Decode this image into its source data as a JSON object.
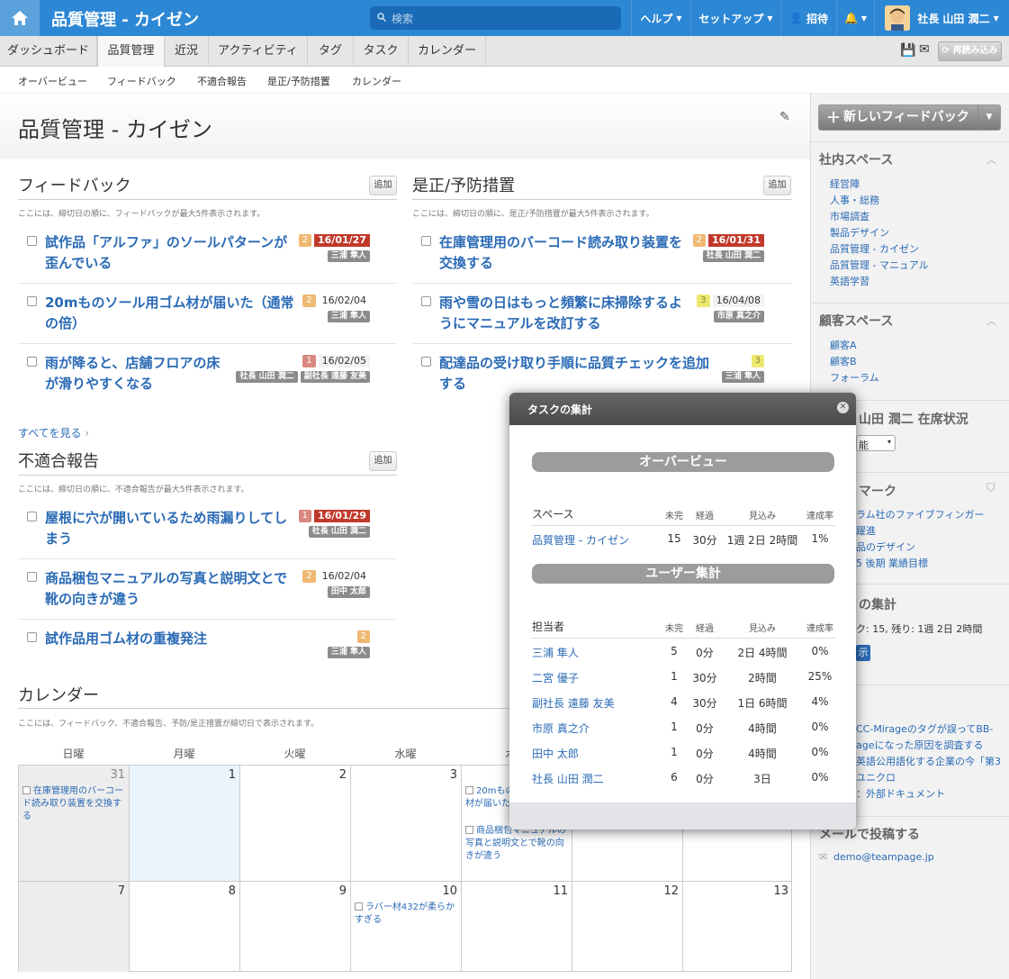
{
  "topbar": {
    "title": "品質管理 - カイゼン",
    "search_placeholder": "検索",
    "help": "ヘルプ",
    "setup": "セットアップ",
    "invite": "招待",
    "user": "社長 山田 潤二"
  },
  "tabs": [
    "ダッシュボード",
    "品質管理",
    "近況",
    "アクティビティ",
    "タグ",
    "タスク",
    "カレンダー"
  ],
  "reload": "再読み込み",
  "subnav": [
    "オーバービュー",
    "フィードバック",
    "不適合報告",
    "是正/予防措置",
    "カレンダー"
  ],
  "page_title": "品質管理 - カイゼン",
  "add_label": "追加",
  "feedback": {
    "title": "フィードバック",
    "desc": "ここには、締切日の順に、フィードバックが最大5件表示されます。",
    "items": [
      {
        "l1": "試作品「アルファ」のソールパターンが",
        "l2": "歪んでいる",
        "prio": "2",
        "date": "16/01/27",
        "who": [
          "三浦 隼人"
        ]
      },
      {
        "l1": "20mものソール用ゴム材が届いた（通常",
        "l2": "の倍）",
        "prio": "2",
        "date": "16/02/04",
        "who": [
          "三浦 隼人"
        ]
      },
      {
        "l1": "雨が降ると、店舗フロアの床",
        "l2": "が滑りやすくなる",
        "prio": "1",
        "date": "16/02/05",
        "who": [
          "社長 山田 潤二",
          "副社長 遠藤 友美"
        ]
      }
    ],
    "see_all": "すべてを見る"
  },
  "capa": {
    "title": "是正/予防措置",
    "desc": "ここには、締切日の順に、是正/予防措置が最大5件表示されます。",
    "items": [
      {
        "l1": "在庫管理用のバーコード読み取り装置を",
        "l2": "交換する",
        "prio": "2",
        "date": "16/01/31",
        "who": [
          "社長 山田 潤二"
        ]
      },
      {
        "l1": "雨や雪の日はもっと頻繁に床掃除するよ",
        "l2": "うにマニュアルを改訂する",
        "prio": "3",
        "date": "16/04/08",
        "who": [
          "市原 真之介"
        ]
      },
      {
        "l1": "配達品の受け取り手順に品質チェックを追加",
        "l2": "する",
        "prio": "3",
        "date": "",
        "who": [
          "三浦 隼人"
        ]
      }
    ]
  },
  "nonconf": {
    "title": "不適合報告",
    "desc": "ここには、締切日の順に、不適合報告が最大5件表示されます。",
    "items": [
      {
        "l1": "屋根に穴が開いているため雨漏りしてし",
        "l2": "まう",
        "prio": "1",
        "date": "16/01/29",
        "who": [
          "社長 山田 潤二"
        ]
      },
      {
        "l1": "商品梱包マニュアルの写真と説明文とで",
        "l2": "靴の向きが違う",
        "prio": "2",
        "date": "16/02/04",
        "who": [
          "田中 太郎"
        ]
      },
      {
        "l1": "試作品用ゴム材の重複発注",
        "l2": "",
        "prio": "2",
        "date": "",
        "who": [
          "三浦 隼人"
        ]
      }
    ]
  },
  "calendar": {
    "title": "カレンダー",
    "desc": "ここには、フィードバック、不適合報告、予防/是正措置が締切日で表示されます。",
    "days": [
      "日曜",
      "月曜",
      "火曜",
      "水曜",
      "木曜",
      "金曜",
      "土曜"
    ],
    "week1": [
      "31",
      "1",
      "2",
      "3",
      "",
      "",
      ""
    ],
    "week2": [
      "7",
      "8",
      "9",
      "10",
      "11",
      "12",
      "13"
    ],
    "ev_31": "在庫管理用のバーコード読み取り装置を交換する",
    "ev_4a": "20mものソール用ゴム材が届いた（通常の倍）",
    "ev_4b": "商品梱包マニュアルの写真と説明文とで靴の向きが違う",
    "ev_10": "ラバー材432が柔らかすぎる"
  },
  "sidebar": {
    "new_btn": "新しいフィードバック",
    "internal_title": "社内スペース",
    "internal": [
      "経営陣",
      "人事・総務",
      "市場調査",
      "製品デザイン",
      "品質管理 - カイゼン",
      "品質管理 - マニュアル",
      "英語学習"
    ],
    "customer_title": "顧客スペース",
    "customer": [
      "顧客A",
      "顧客B",
      "フォーラム"
    ],
    "presence_title": "山田 潤二 在席状況",
    "presence_value": "能",
    "bookmark_title": "マーク",
    "bookmarks": [
      "ラム社のファイブフィンガー",
      "躍進",
      "品のデザイン",
      "5 後期 業績目標"
    ],
    "task_title": "の集計",
    "task_summary": "ク: 15, 残り: 1週 2日 2時間",
    "task_btn": "示",
    "recent": [
      "CC-Mirageのタグが誤ってBB-",
      "ageになった原因を調査する",
      "英語公用語化する企業の今「第3",
      "ユニクロ",
      "：外部ドキュメント"
    ],
    "email_title": "メールで投稿する",
    "email": "demo@teampage.jp"
  },
  "modal": {
    "title": "タスクの集計",
    "overview": "オーバービュー",
    "user_summary": "ユーザー集計",
    "cols_space": [
      "スペース",
      "未完",
      "経過",
      "見込み",
      "達成率"
    ],
    "space_row": [
      "品質管理 - カイゼン",
      "15",
      "30分",
      "1週 2日 2時間",
      "1%"
    ],
    "cols_user": [
      "担当者",
      "未完",
      "経過",
      "見込み",
      "達成率"
    ],
    "user_rows": [
      [
        "三浦 隼人",
        "5",
        "0分",
        "2日 4時間",
        "0%"
      ],
      [
        "二宮 優子",
        "1",
        "30分",
        "2時間",
        "25%"
      ],
      [
        "副社長 遠藤 友美",
        "4",
        "30分",
        "1日 6時間",
        "4%"
      ],
      [
        "市原 真之介",
        "1",
        "0分",
        "4時間",
        "0%"
      ],
      [
        "田中 太郎",
        "1",
        "0分",
        "4時間",
        "0%"
      ],
      [
        "社長 山田 潤二",
        "6",
        "0分",
        "3日",
        "0%"
      ]
    ]
  },
  "colors": {
    "topbar": "#2c87d4",
    "link": "#2a6ab5",
    "due": "#c0392b"
  }
}
